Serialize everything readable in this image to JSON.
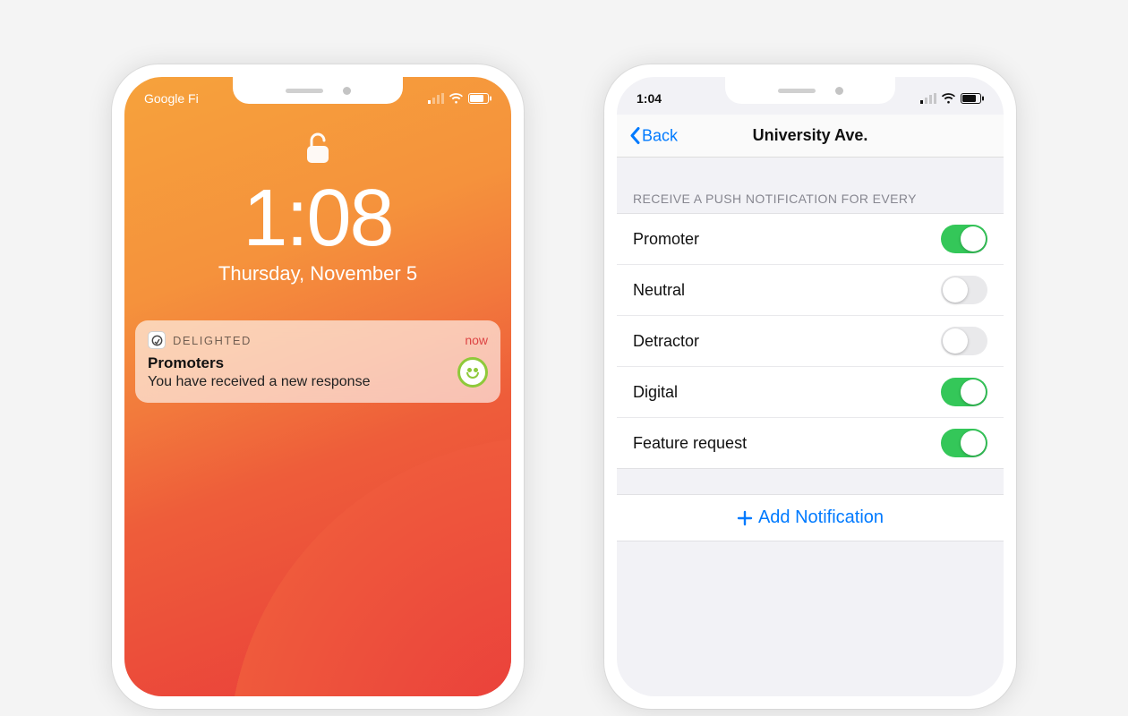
{
  "left": {
    "carrier": "Google Fi",
    "time": "1:08",
    "date": "Thursday, November 5",
    "notification": {
      "app_name": "DELIGHTED",
      "when": "now",
      "title": "Promoters",
      "message": "You have received a new response"
    }
  },
  "right": {
    "status_time": "1:04",
    "back_label": "Back",
    "title": "University Ave.",
    "section_header": "RECEIVE A PUSH NOTIFICATION FOR EVERY",
    "rows": [
      {
        "label": "Promoter",
        "on": true
      },
      {
        "label": "Neutral",
        "on": false
      },
      {
        "label": "Detractor",
        "on": false
      },
      {
        "label": "Digital",
        "on": true
      },
      {
        "label": "Feature request",
        "on": true
      }
    ],
    "add_label": "Add Notification"
  },
  "colors": {
    "ios_blue": "#007aff",
    "ios_green": "#34c759"
  }
}
